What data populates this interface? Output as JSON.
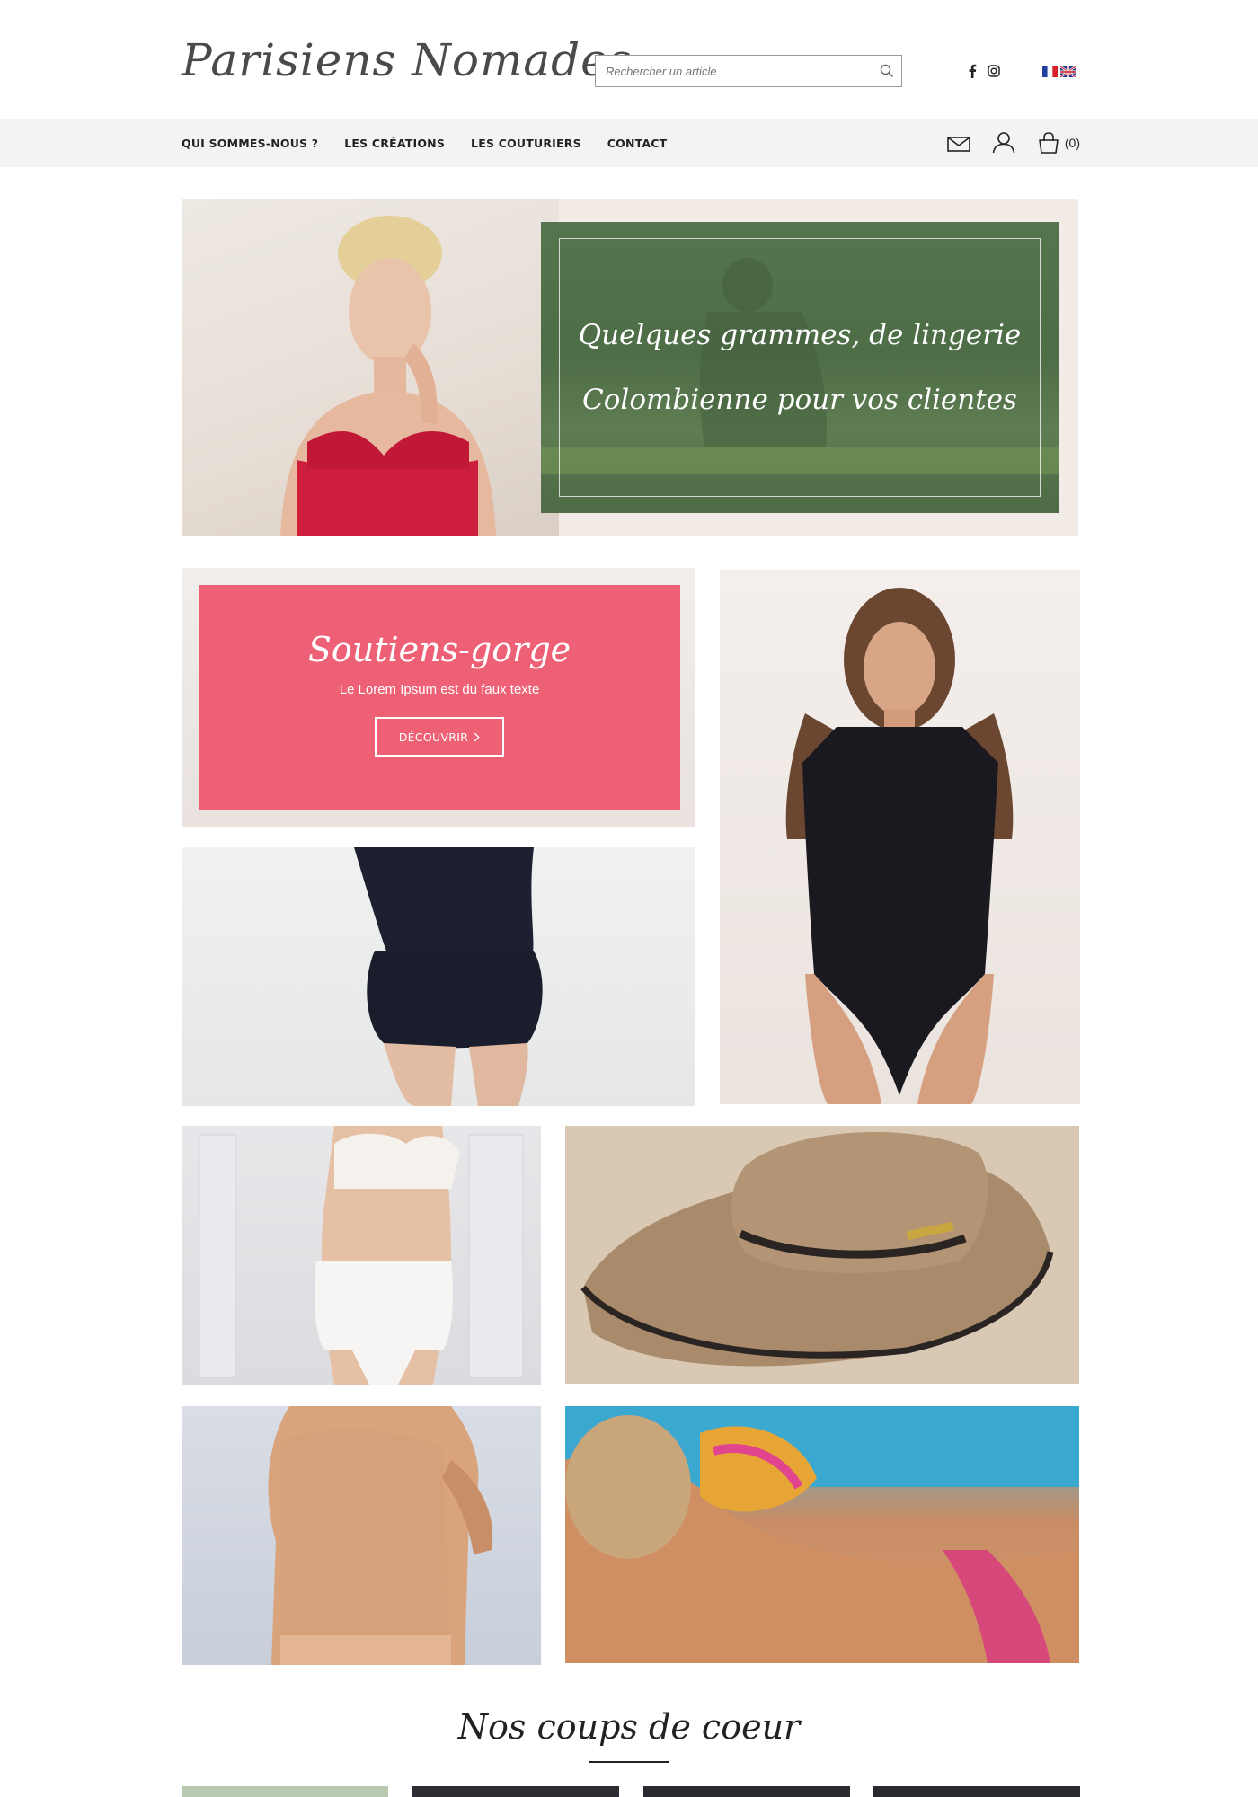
{
  "header": {
    "logo": "Parisiens Nomades",
    "search_placeholder": "Rechercher un article"
  },
  "icons": {
    "search": "search-icon",
    "facebook": "facebook-icon",
    "instagram": "instagram-icon",
    "flag_fr": "flag-fr-icon",
    "flag_uk": "flag-uk-icon",
    "mail": "mail-icon",
    "user": "user-icon",
    "cart": "shopping-bag-icon"
  },
  "nav": {
    "items": [
      "QUI SOMMES-NOUS ?",
      "LES CRÉATIONS",
      "LES COUTURIERS",
      "CONTACT"
    ],
    "cart_count": "(0)"
  },
  "hero": {
    "line1": "Quelques grammes, de lingerie",
    "line2": "Colombienne pour vos clientes"
  },
  "promo": {
    "title": "Soutiens-gorge",
    "subtitle": "Le Lorem Ipsum est du faux texte",
    "button": "DÉCOUVRIR"
  },
  "section": {
    "title": "Nos coups de coeur"
  },
  "colors": {
    "promo_pink": "#EE556C",
    "hero_green": "#55754F",
    "navbar_bg": "#F3F3F3"
  }
}
